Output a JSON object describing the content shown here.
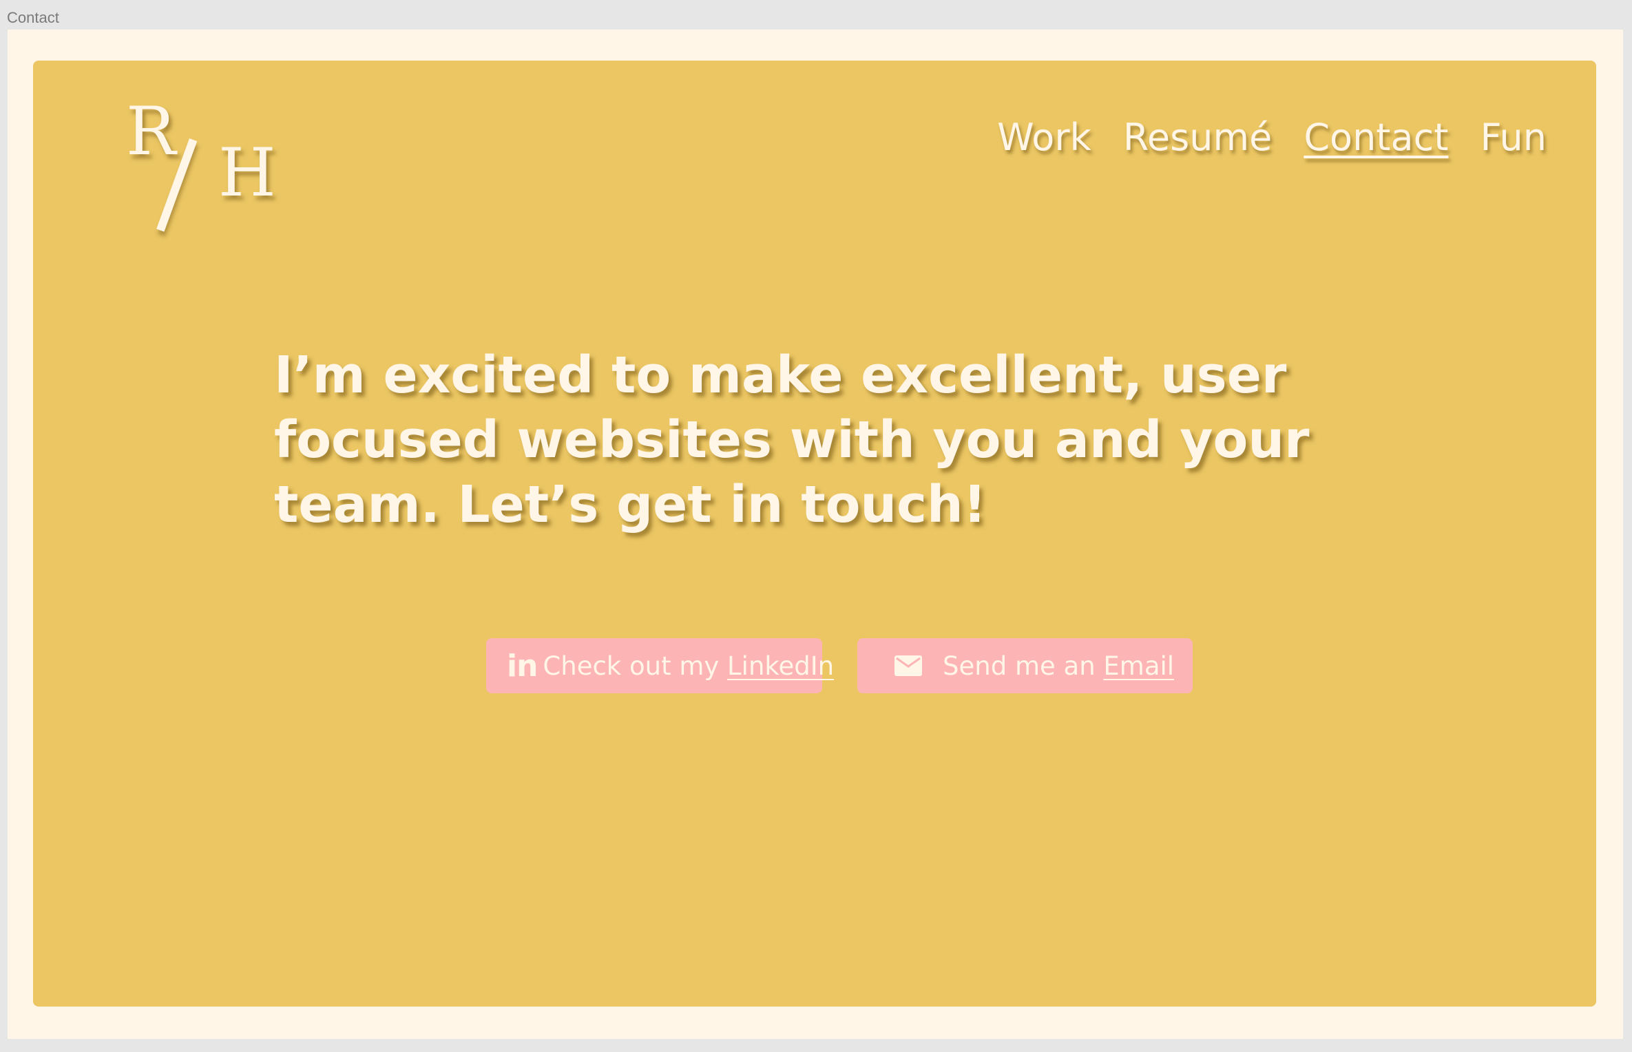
{
  "window": {
    "frame_label": "Contact"
  },
  "logo": {
    "first_letter": "R",
    "second_letter": "H"
  },
  "nav": {
    "items": [
      {
        "label": "Work"
      },
      {
        "label": "Resumé"
      },
      {
        "label": "Contact",
        "active": true
      },
      {
        "label": "Fun"
      }
    ]
  },
  "hero": {
    "headline": "I’m excited to make excellent, user focused websites with you and your team. Let’s get in touch!"
  },
  "buttons": {
    "linkedin": {
      "icon": "linkedin-icon",
      "icon_text": "in",
      "prefix": "Check out my ",
      "link_text": "LinkedIn"
    },
    "email": {
      "icon": "mail-icon",
      "prefix": "Send me an ",
      "link_text": "Email"
    }
  },
  "colors": {
    "card_background": "#ebc663",
    "frame_background": "#fff6e8",
    "button_background": "#fdb4b4",
    "text": "#fff6e8"
  }
}
